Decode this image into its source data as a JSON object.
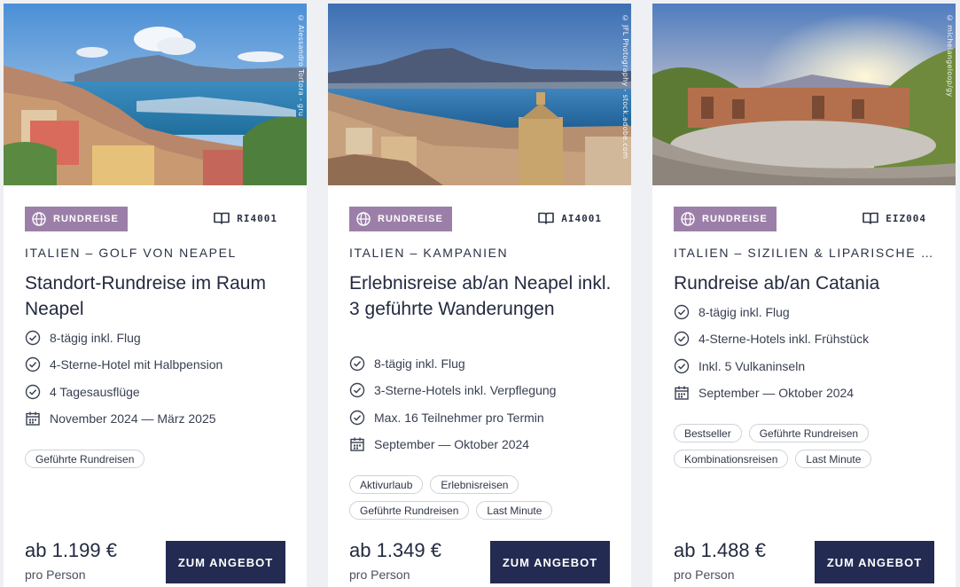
{
  "colors": {
    "badge_bg": "#9c7fa8",
    "cta_bg": "#232b52",
    "text": "#232a40",
    "page_bg": "#eef0f3"
  },
  "cards": [
    {
      "photo_credit": "© Alessandro Tortora - gru",
      "badge": "RUNDREISE",
      "code": "RI4001",
      "region": "ITALIEN – GOLF VON NEAPEL",
      "title": "Standort-Rundreise im Raum Neapel",
      "features": [
        {
          "icon": "check-circle-icon",
          "text": "8-tägig inkl. Flug"
        },
        {
          "icon": "check-circle-icon",
          "text": "4-Sterne-Hotel mit Halbpension"
        },
        {
          "icon": "check-circle-icon",
          "text": "4 Tagesausflüge"
        },
        {
          "icon": "calendar-icon",
          "text": "November 2024 — März 2025"
        }
      ],
      "tags": [
        "Geführte Rundreisen"
      ],
      "price": "ab 1.199 €",
      "price_unit": "pro Person",
      "cta": "ZUM ANGEBOT"
    },
    {
      "photo_credit": "© JFL Photography - stock.adobe.com",
      "badge": "RUNDREISE",
      "code": "AI4001",
      "region": "ITALIEN – KAMPANIEN",
      "title": "Erlebnisreise ab/an Neapel inkl. 3 geführte Wanderungen",
      "features": [
        {
          "icon": "check-circle-icon",
          "text": "8-tägig inkl. Flug"
        },
        {
          "icon": "check-circle-icon",
          "text": "3-Sterne-Hotels inkl. Verpflegung"
        },
        {
          "icon": "check-circle-icon",
          "text": "Max. 16 Teilnehmer pro Termin"
        },
        {
          "icon": "calendar-icon",
          "text": "September — Oktober 2024"
        }
      ],
      "tags": [
        "Aktivurlaub",
        "Erlebnisreisen",
        "Geführte Rundreisen",
        "Last Minute"
      ],
      "price": "ab 1.349 €",
      "price_unit": "pro Person",
      "cta": "ZUM ANGEBOT"
    },
    {
      "photo_credit": "© michelangeloop/gy",
      "badge": "RUNDREISE",
      "code": "EIZ004",
      "region": "ITALIEN – SIZILIEN & LIPARISCHE INSELN",
      "title": "Rundreise ab/an Catania",
      "features": [
        {
          "icon": "check-circle-icon",
          "text": "8-tägig inkl. Flug"
        },
        {
          "icon": "check-circle-icon",
          "text": "4-Sterne-Hotels inkl. Frühstück"
        },
        {
          "icon": "check-circle-icon",
          "text": "Inkl. 5 Vulkaninseln"
        },
        {
          "icon": "calendar-icon",
          "text": "September — Oktober 2024"
        }
      ],
      "tags": [
        "Bestseller",
        "Geführte Rundreisen",
        "Kombinationsreisen",
        "Last Minute"
      ],
      "price": "ab 1.488 €",
      "price_unit": "pro Person",
      "cta": "ZUM ANGEBOT"
    }
  ]
}
